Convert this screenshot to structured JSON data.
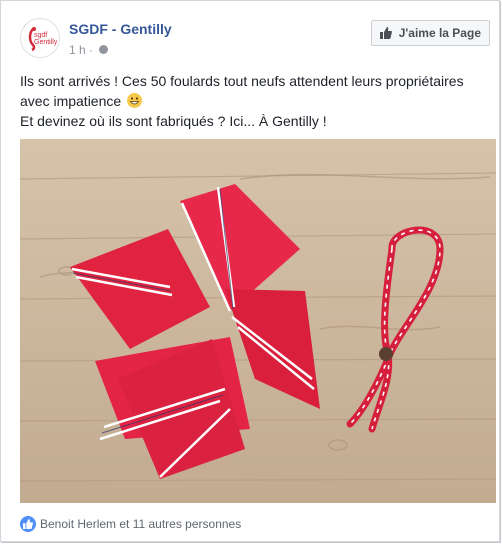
{
  "post": {
    "page_name": "SGDF - Gentilly",
    "avatar_text": "sgdf Gentilly",
    "time": "1 h",
    "dot": "·",
    "like_page_label": "J'aime la Page",
    "text_line1": "Ils sont arrivés ! Ces 50 foulards tout neufs attendent leurs propriétaires avec impatience",
    "text_line2": "Et devinez où ils sont fabriqués ? Ici... À Gentilly !",
    "emoji": "grinning-face-emoji",
    "photo": {
      "subject": "red scout scarves on wood floor",
      "colors": {
        "wood": "#cbb69d",
        "scarf": "#e0243f",
        "stripe": "#ffffff"
      }
    },
    "reactions_text": "Benoit Herlem et 11 autres personnes"
  },
  "colors": {
    "link": "#365899",
    "meta": "#90949c",
    "text": "#1d2129",
    "like_blue": "#4e8ff7"
  }
}
